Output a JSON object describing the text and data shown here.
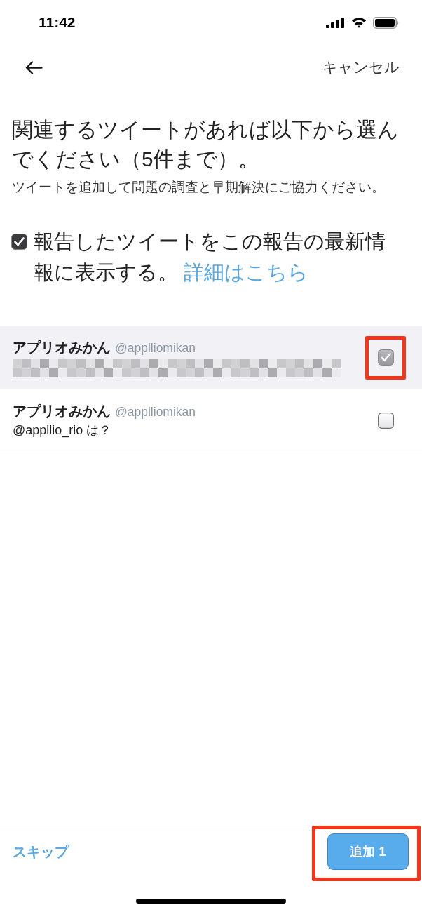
{
  "status_bar": {
    "time": "11:42"
  },
  "header": {
    "cancel": "キャンセル"
  },
  "heading": "関連するツイートがあれば以下から選んでください（5件まで）。",
  "subtitle": "ツイートを追加して問題の調査と早期解決にご協力ください。",
  "show_in_report": {
    "checked": true,
    "label": "報告したツイートをこの報告の最新情報に表示する。",
    "link": "詳細はこちら"
  },
  "tweets": [
    {
      "name": "アプリオみかん",
      "handle": "@applliomikan",
      "redacted": true,
      "selected": true,
      "highlighted": true
    },
    {
      "name": "アプリオみかん",
      "handle": "@applliomikan",
      "text": "@appllio_rio は？",
      "redacted": false,
      "selected": false,
      "highlighted": false
    }
  ],
  "footer": {
    "skip": "スキップ",
    "add_button": {
      "label": "追加 1",
      "highlighted": true
    }
  }
}
